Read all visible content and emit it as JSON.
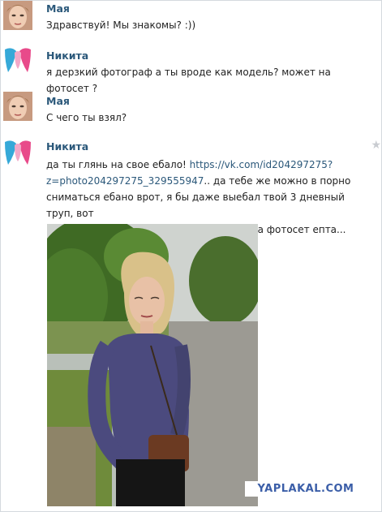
{
  "messages": [
    {
      "sender": "Мая",
      "text": "Здравствуй! Мы знакомы? :))"
    },
    {
      "sender": "Никита",
      "text": "я дерзкий фотограф а ты вроде как модель? может на фотосет ?"
    },
    {
      "sender": "Мая",
      "text": "С чего ты взял?"
    },
    {
      "sender": "Никита",
      "text_prefix": "да ты глянь на свое ебало! ",
      "link_line1": "https://vk.com/id204297275?",
      "link_line2": "z=photo204297275_329555947",
      "text_rest_line2": ".. да тебе же можно в порно",
      "text_line3": "сниматься ебано врот, я бы даже выебал твой 3 дневный труп, вот",
      "text_line4": "насколько ты охуенная, так что пошли на фотосет епта..."
    }
  ],
  "watermark": "YAPLAKAL.COM",
  "icons": {
    "star": "star-icon",
    "avatar_maya": "avatar-woman",
    "avatar_nikita": "avatar-faces-logo"
  },
  "colors": {
    "name": "#2b587a",
    "link": "#2b587a",
    "watermark": "#3b5ea8"
  }
}
